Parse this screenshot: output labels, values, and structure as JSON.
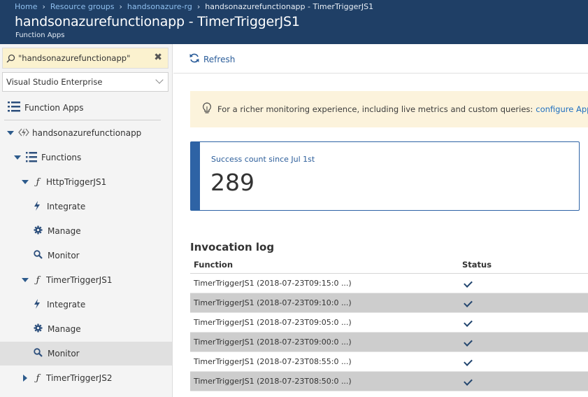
{
  "breadcrumb": {
    "items": [
      "Home",
      "Resource groups",
      "handsonazure-rg"
    ],
    "current": "handsonazurefunctionapp - TimerTriggerJS1"
  },
  "header": {
    "title": "handsonazurefunctionapp - TimerTriggerJS1",
    "subtitle": "Function Apps"
  },
  "sidebar": {
    "search": {
      "value": "\"handsonazurefunctionapp\"",
      "clear_label": "✖"
    },
    "subscription": "Visual Studio Enterprise",
    "function_apps_label": "Function Apps",
    "app_name": "handsonazurefunctionapp",
    "functions_label": "Functions",
    "functions": [
      {
        "name": "HttpTriggerJS1",
        "children": [
          "Integrate",
          "Manage",
          "Monitor"
        ]
      },
      {
        "name": "TimerTriggerJS1",
        "children": [
          "Integrate",
          "Manage",
          "Monitor"
        ]
      },
      {
        "name": "TimerTriggerJS2"
      }
    ],
    "selected": "TimerTriggerJS1 / Monitor"
  },
  "toolbar": {
    "refresh_label": "Refresh"
  },
  "banner": {
    "text": "For a richer monitoring experience, including live metrics and custom queries:",
    "link": "configure Application"
  },
  "kpi": {
    "label": "Success count since Jul 1st",
    "value": "289"
  },
  "invocation_log": {
    "title": "Invocation log",
    "columns": [
      "Function",
      "Status"
    ],
    "rows": [
      {
        "function": "TimerTriggerJS1 (2018-07-23T09:15:0 ...)",
        "status": "success"
      },
      {
        "function": "TimerTriggerJS1 (2018-07-23T09:10:0 ...)",
        "status": "success"
      },
      {
        "function": "TimerTriggerJS1 (2018-07-23T09:05:0 ...)",
        "status": "success"
      },
      {
        "function": "TimerTriggerJS1 (2018-07-23T09:00:0 ...)",
        "status": "success"
      },
      {
        "function": "TimerTriggerJS1 (2018-07-23T08:55:0 ...)",
        "status": "success"
      },
      {
        "function": "TimerTriggerJS1 (2018-07-23T08:50:0 ...)",
        "status": "success"
      }
    ]
  },
  "colors": {
    "header_bg": "#1f3f66",
    "accent_blue": "#2e63a5",
    "banner_bg": "#fcf3dc",
    "selected_row": "#e0e0e0"
  }
}
